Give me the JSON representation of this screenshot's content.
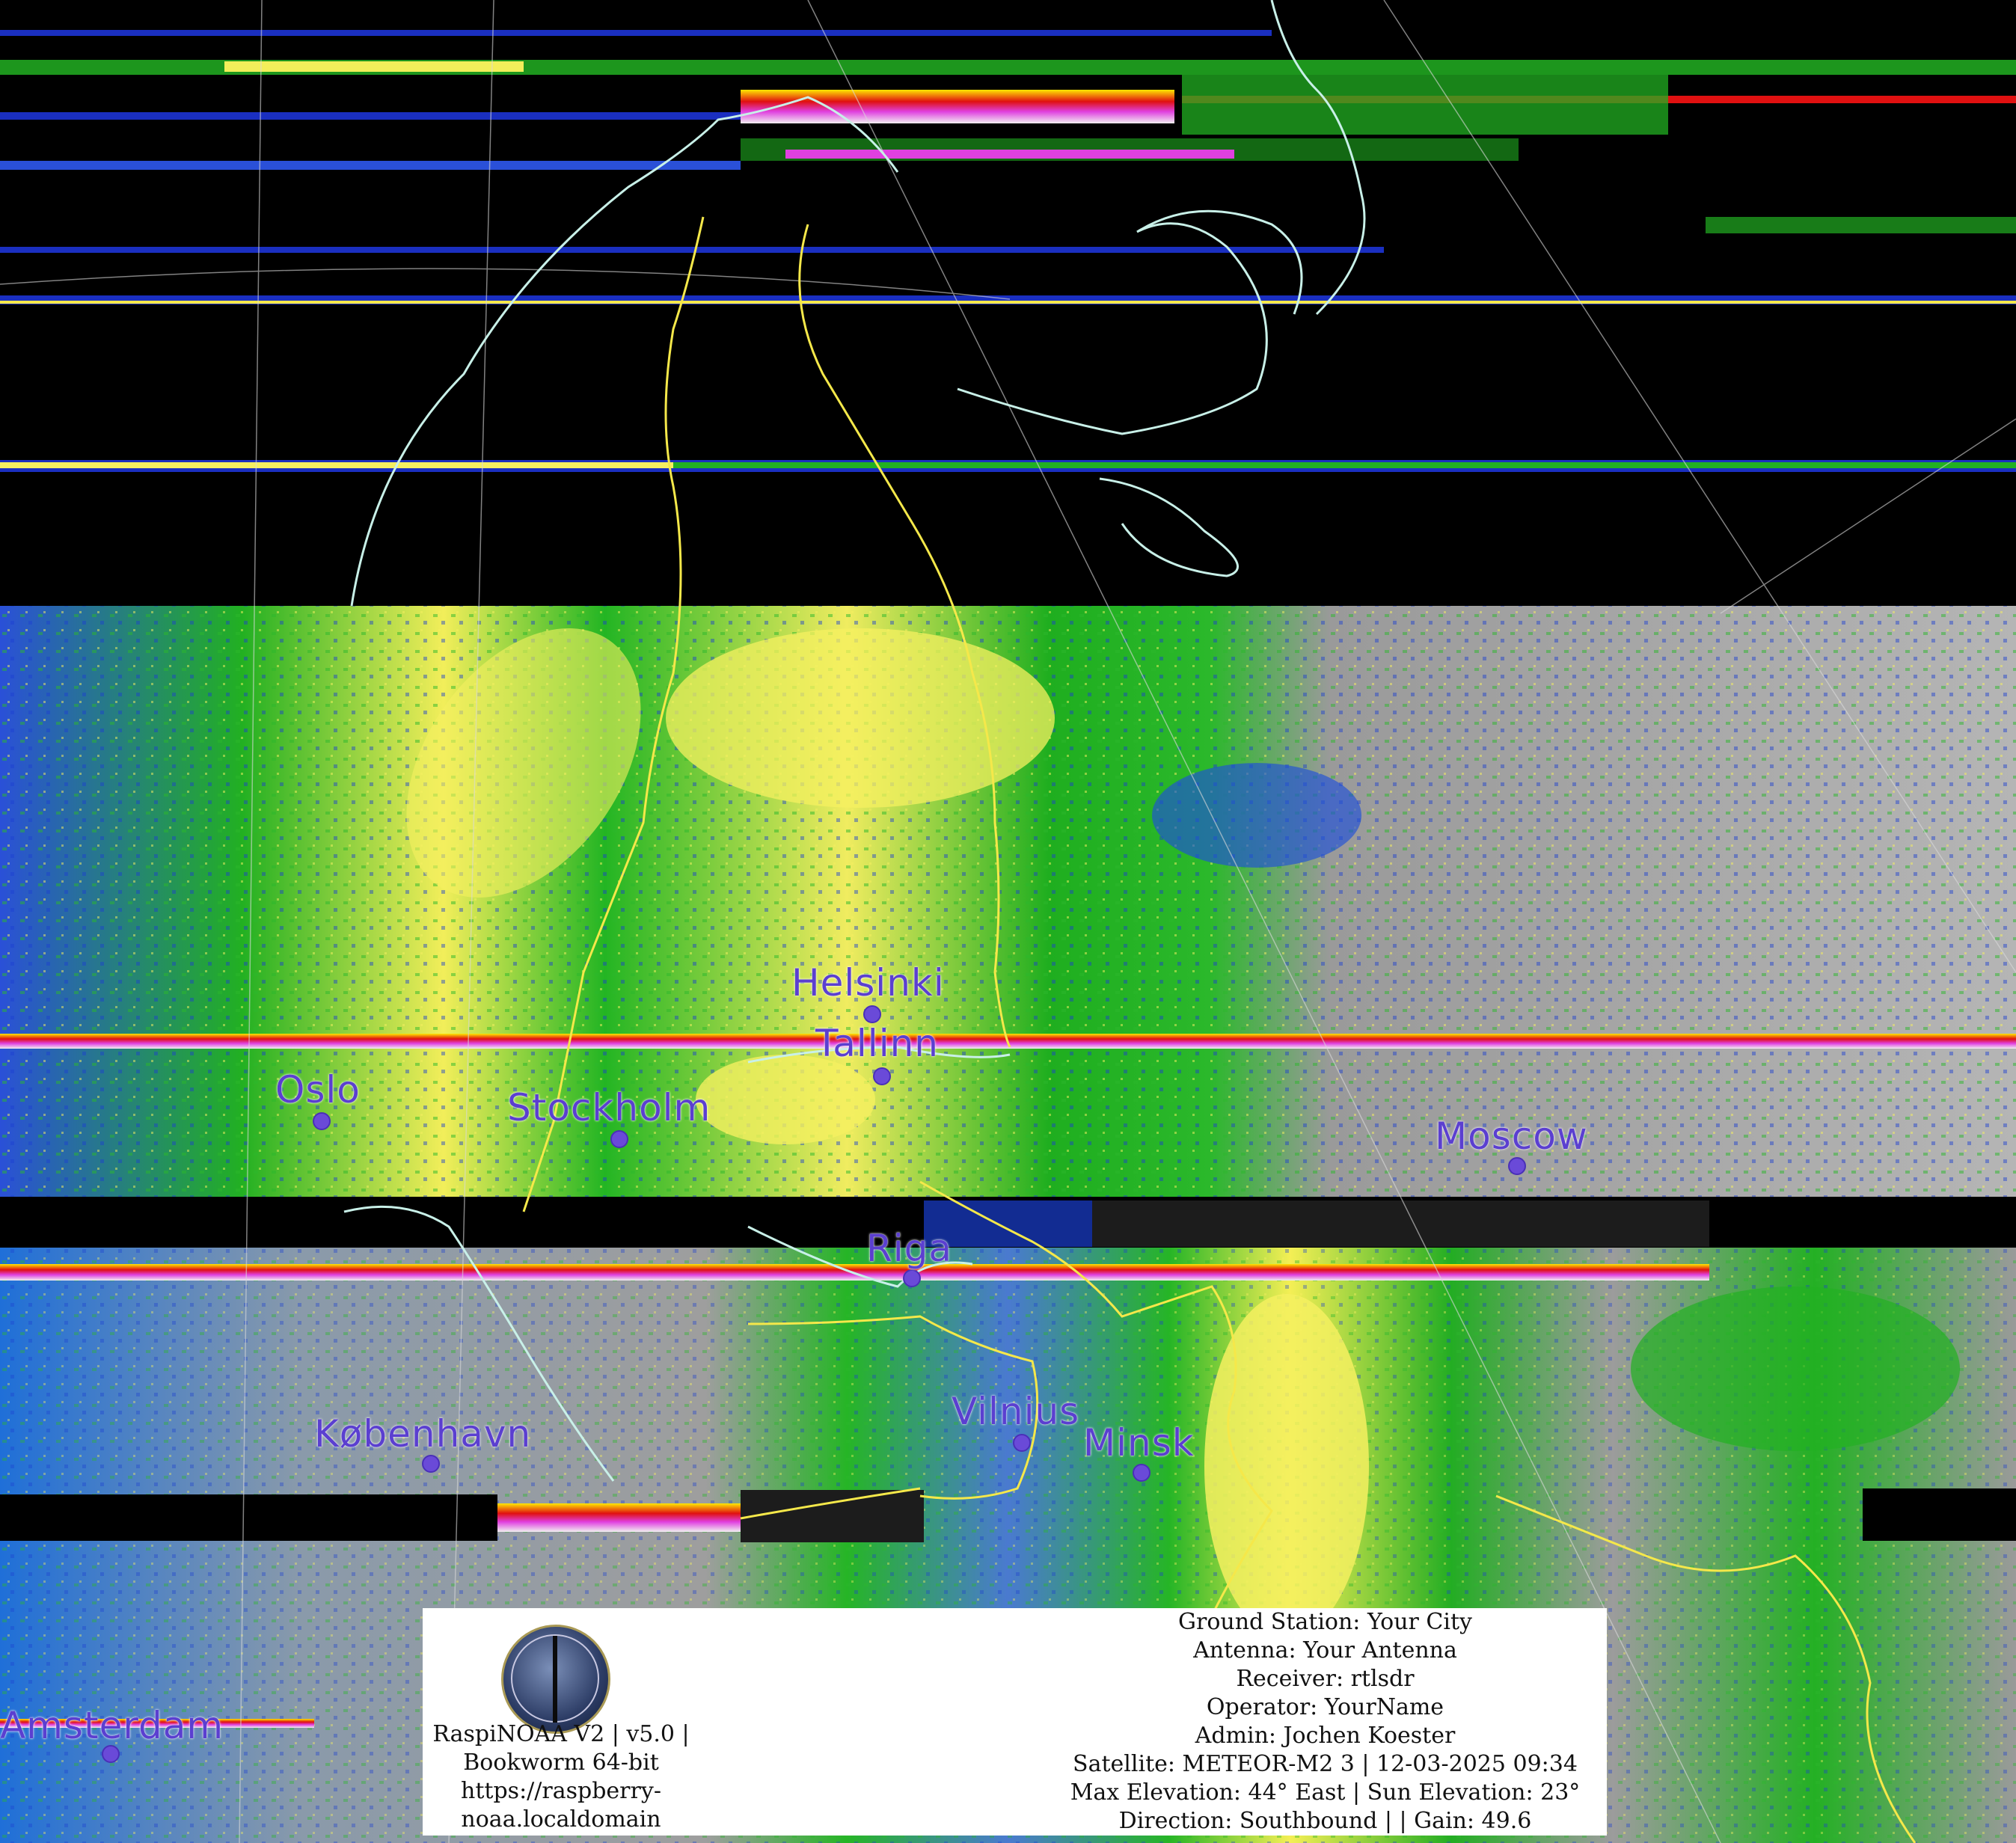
{
  "cities": [
    {
      "id": "helsinki",
      "name": "Helsinki"
    },
    {
      "id": "tallinn",
      "name": "Tallinn"
    },
    {
      "id": "oslo",
      "name": "Oslo"
    },
    {
      "id": "stockholm",
      "name": "Stockholm"
    },
    {
      "id": "moscow",
      "name": "Moscow"
    },
    {
      "id": "riga",
      "name": "Riga"
    },
    {
      "id": "kobenhavn",
      "name": "København"
    },
    {
      "id": "vilnius",
      "name": "Vilnius"
    },
    {
      "id": "minsk",
      "name": "Minsk"
    },
    {
      "id": "amsterdam",
      "name": "Amsterdam"
    }
  ],
  "info_left": [
    "RaspiNOAA V2 | v5.0 |",
    "Bookworm 64-bit",
    "https://raspberry-",
    "noaa.localdomain"
  ],
  "info_right": [
    "Ground Station: Your City",
    "Antenna: Your Antenna",
    "Receiver: rtlsdr",
    "Operator: YourName",
    "Admin: Jochen Koester",
    "Satellite: METEOR-M2 3 | 12-03-2025 09:34",
    "Max Elevation: 44° East | Sun Elevation: 23°",
    "Direction: Southbound | | Gain: 49.6"
  ],
  "colors": {
    "land_green": "#1db81d",
    "cloud_yellow": "#f5f060",
    "cloud_gray": "#b8b8b8",
    "water_blue": "#1a3fd0",
    "noise_red": "#e01010",
    "noise_magenta": "#e040e0",
    "border_yellow": "#f5e84a",
    "coast_cyan": "#c8f0e8",
    "city_purple": "#5b3fd0"
  }
}
